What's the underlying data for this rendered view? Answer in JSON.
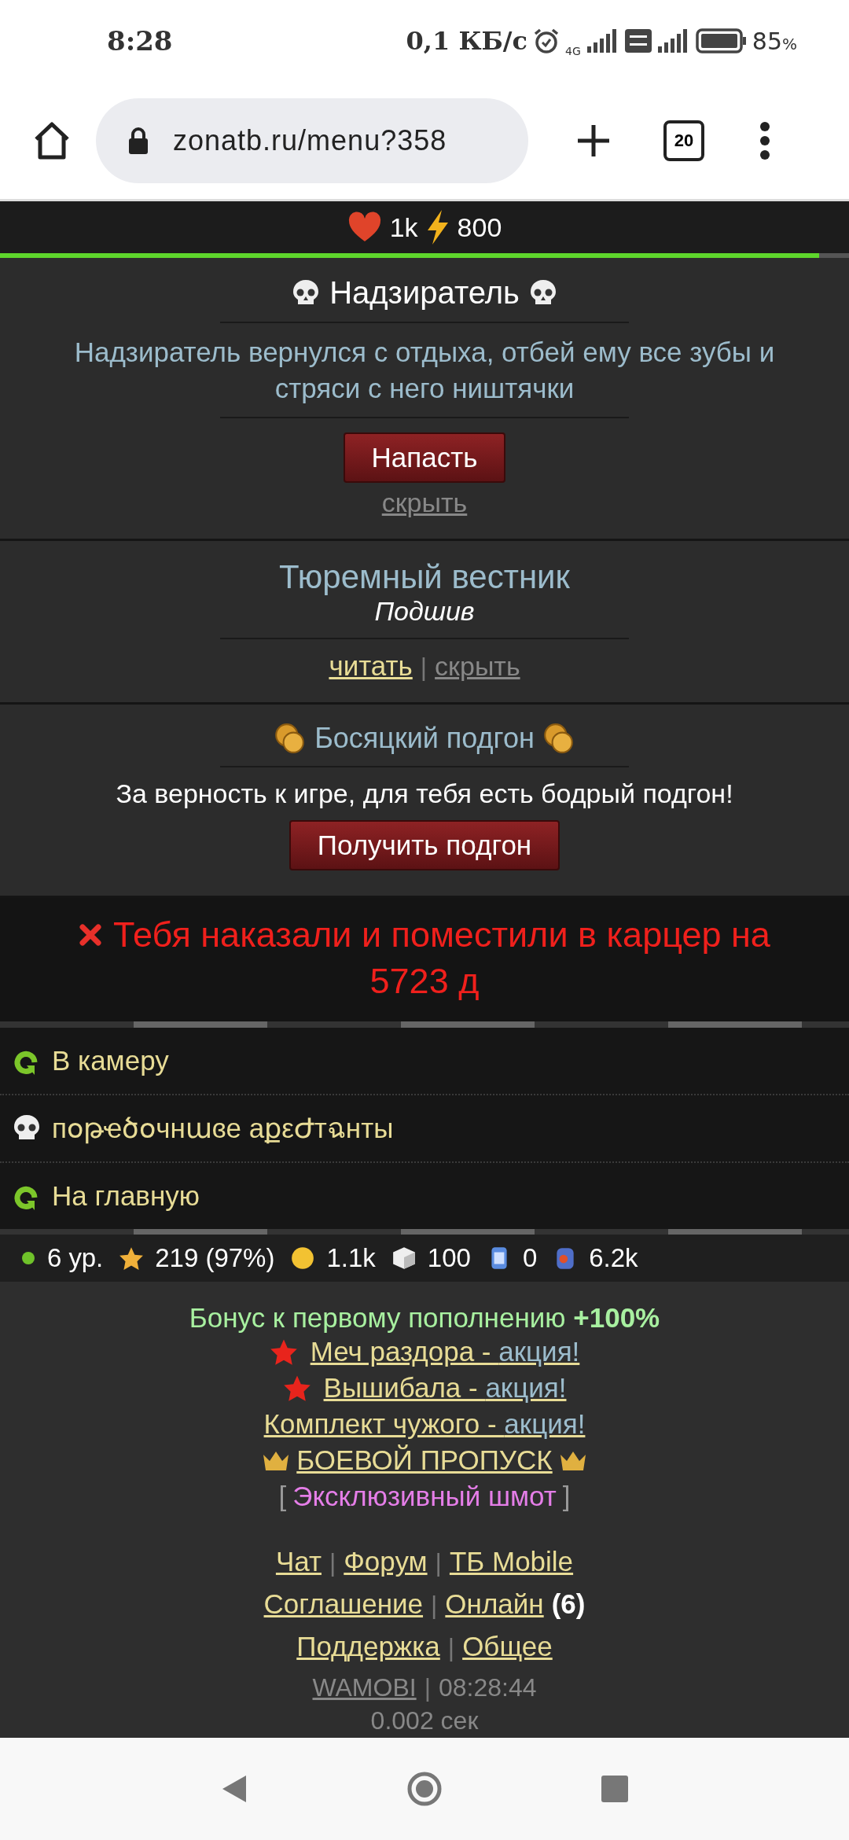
{
  "status_bar": {
    "time": "8:28",
    "net_speed": "0,1 КБ/с",
    "network": "4G",
    "battery": "85",
    "battery_unit": "%"
  },
  "browser": {
    "url": "zonatb.ru/menu?358",
    "tabs_count": "20"
  },
  "top_stats": {
    "hp": "1k",
    "energy": "800",
    "level": 0.965
  },
  "boss": {
    "title": "Надзиратель",
    "text": "Надзиратель вернулся с отдыха, отбей ему все зубы и стряси с него ништячки",
    "button": "Напасть",
    "hide": "скрыть"
  },
  "news": {
    "title": "Тюремный вестник",
    "subtitle": "Подшив",
    "read": "читать",
    "separator": "|",
    "hide": "скрыть"
  },
  "gift": {
    "title": "Босяцкий подгон",
    "text": "За верность к игре, для тебя есть бодрый подгон!",
    "button": "Получить подгон"
  },
  "alert": {
    "text": "Тебя наказали и поместили в карцер на 5723 д"
  },
  "menu": [
    {
      "kind": "arrow",
      "label": "В камеру"
    },
    {
      "kind": "skull",
      "label": "пօթҽծօчнաɞе aքεԺтฉнты"
    },
    {
      "kind": "arrow",
      "label": "На главную"
    }
  ],
  "stats": [
    {
      "kind": "level",
      "value": "6 ур."
    },
    {
      "kind": "star",
      "value": "219 (97%)"
    },
    {
      "kind": "coin",
      "value": "1.1k"
    },
    {
      "kind": "sugar",
      "value": "100"
    },
    {
      "kind": "jar",
      "value": "0"
    },
    {
      "kind": "jar2",
      "value": "6.2k"
    }
  ],
  "bonus": "Бонус к первому пополнению **+100%**",
  "promos": [
    {
      "kind": "star",
      "label": "Меч раздора - ",
      "suffix": "акция!"
    },
    {
      "kind": "star",
      "label": "Вышибала - ",
      "suffix": "акция!"
    },
    {
      "kind": "plain",
      "label": "Комплект чужого - ",
      "suffix": "акция!"
    },
    {
      "kind": "crown",
      "label": "БОЕВОЙ ПРОПУСК"
    },
    {
      "kind": "bracket",
      "open": "[",
      "label": "Эксклюзивный шмот",
      "close": "]"
    }
  ],
  "footer_lines": [
    [
      {
        "label": "Чат"
      },
      {
        "label": "Форум"
      },
      {
        "label": "ТБ Mobile"
      }
    ],
    [
      {
        "label": "Соглашение"
      },
      {
        "label": "Онлайн",
        "count": "(6)"
      }
    ],
    [
      {
        "label": "Поддержка"
      },
      {
        "label": "Общее"
      }
    ]
  ],
  "footer_separator": "|",
  "brand": "WAMOBI",
  "clock": "08:28:44",
  "gen_time": "0.002 сек"
}
